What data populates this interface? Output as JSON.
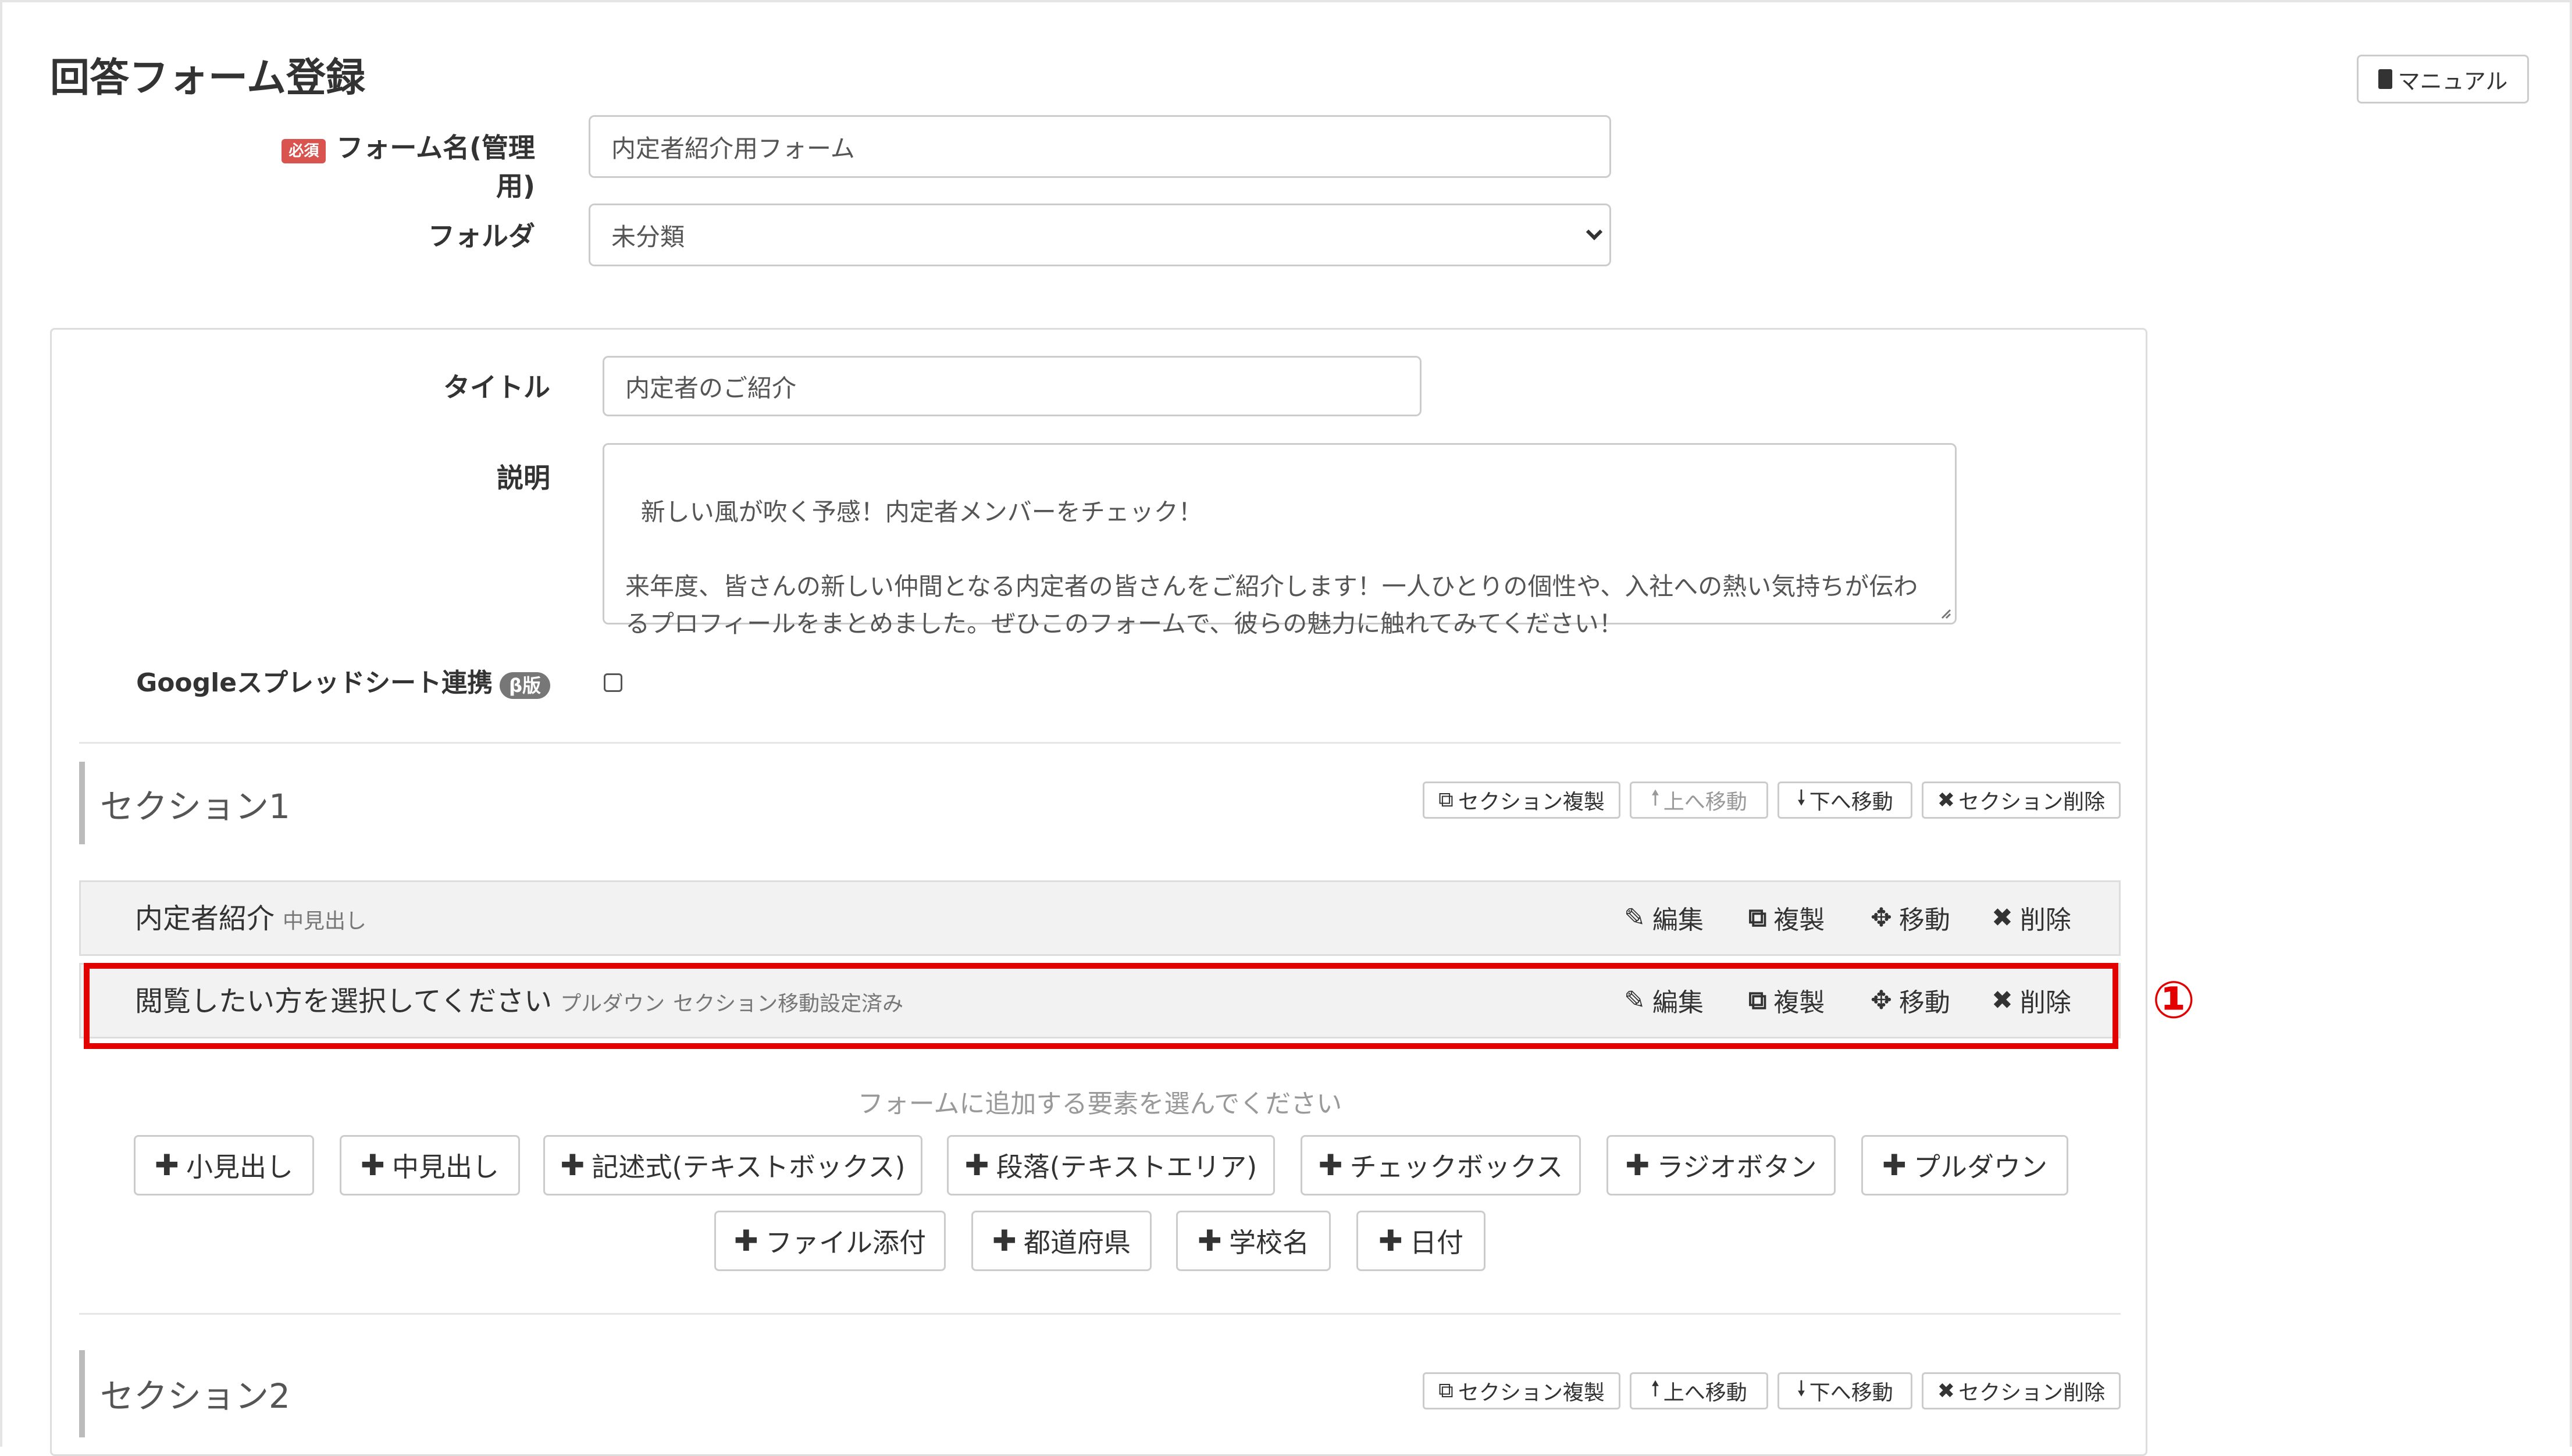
{
  "header": {
    "title": "回答フォーム登録",
    "manual_label": "マニュアル"
  },
  "form": {
    "required_badge": "必須",
    "name_label": "フォーム名(管理用)",
    "name_value": "内定者紹介用フォーム",
    "folder_label": "フォルダ",
    "folder_value": "未分類"
  },
  "panel": {
    "title_label": "タイトル",
    "title_value": "内定者のご紹介",
    "desc_label": "説明",
    "desc_value": "新しい風が吹く予感！内定者メンバーをチェック！\n\n来年度、皆さんの新しい仲間となる内定者の皆さんをご紹介します！一人ひとりの個性や、入社への熱い気持ちが伝わるプロフィールをまとめました。ぜひこのフォームで、彼らの魅力に触れてみてください！",
    "google_label": "Googleスプレッドシート連携",
    "beta_badge": "β版"
  },
  "section_actions": {
    "copy": "セクション複製",
    "up": "上へ移動",
    "down": "下へ移動",
    "delete": "セクション削除"
  },
  "item_actions": {
    "edit": "編集",
    "copy": "複製",
    "move": "移動",
    "delete": "削除"
  },
  "sections": [
    {
      "title": "セクション1",
      "items": [
        {
          "title": "内定者紹介",
          "type": "中見出し",
          "note": ""
        },
        {
          "title": "閲覧したい方を選択してください",
          "type": "プルダウン",
          "note": "セクション移動設定済み"
        }
      ]
    },
    {
      "title": "セクション2"
    }
  ],
  "annotation": {
    "marker": "①"
  },
  "add_elements": {
    "hint": "フォームに追加する要素を選んでください",
    "buttons": [
      "小見出し",
      "中見出し",
      "記述式(テキストボックス)",
      "段落(テキストエリア)",
      "チェックボックス",
      "ラジオボタン",
      "プルダウン",
      "ファイル添付",
      "都道府県",
      "学校名",
      "日付"
    ]
  },
  "colors": {
    "highlight": "#e30000",
    "required_badge": "#d9534f",
    "beta_badge": "#777777"
  },
  "icons": [
    "book-icon",
    "caret-down-icon",
    "copy-icon",
    "arrow-up-icon",
    "arrow-down-icon",
    "close-icon",
    "pencil-icon",
    "move-icon",
    "plus-icon"
  ]
}
